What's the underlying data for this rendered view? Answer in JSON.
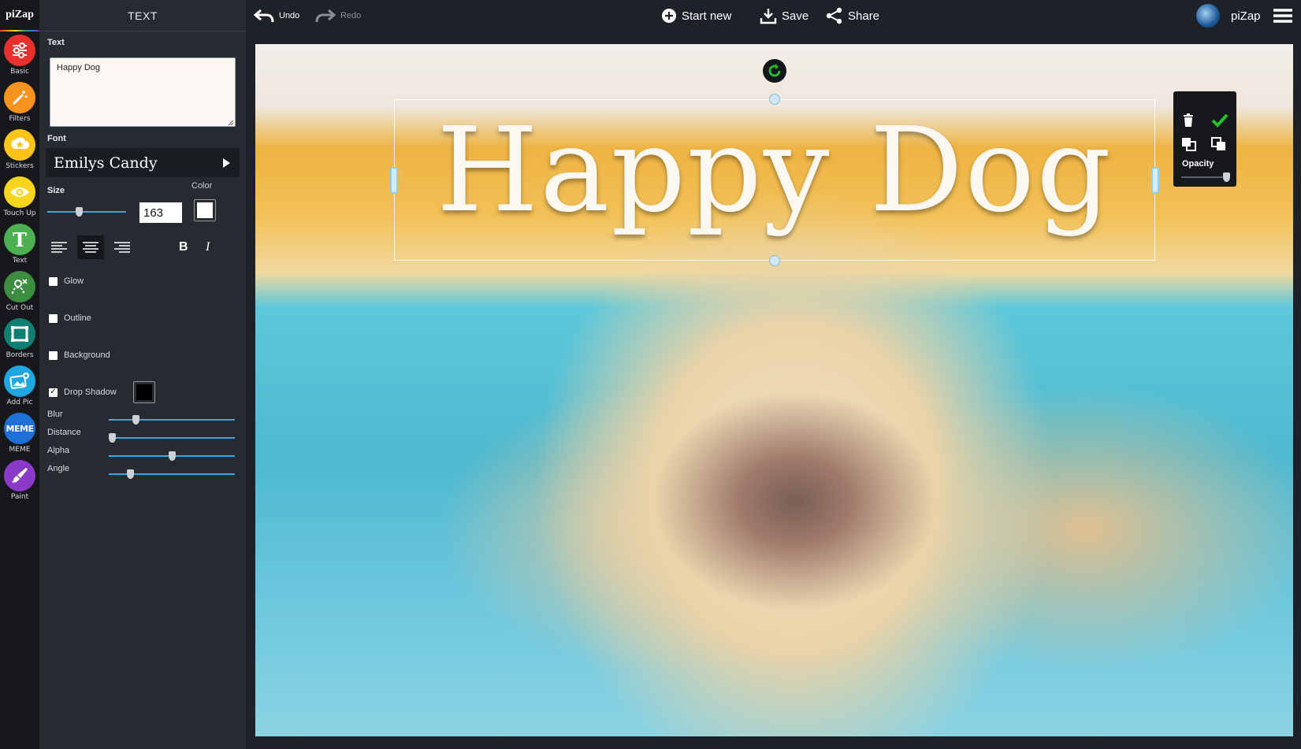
{
  "app": {
    "logo": "piZap"
  },
  "tools": [
    {
      "label": "Basic",
      "icon": "sliders-icon",
      "color": "#e8302d"
    },
    {
      "label": "Filters",
      "icon": "magic-wand-icon",
      "color": "#f7931e"
    },
    {
      "label": "Stickers",
      "icon": "stickers-icon",
      "color": "#fcc419"
    },
    {
      "label": "Touch Up",
      "icon": "eye-icon",
      "color": "#f7d51d"
    },
    {
      "label": "Text",
      "icon": "text-t-icon",
      "color": "#4caf50"
    },
    {
      "label": "Cut Out",
      "icon": "cutout-person-icon",
      "color": "#3c8d40"
    },
    {
      "label": "Borders",
      "icon": "border-frame-icon",
      "color": "#0f7f72"
    },
    {
      "label": "Add Pic",
      "icon": "add-picture-icon",
      "color": "#1ea7e0"
    },
    {
      "label": "MEME",
      "icon": "meme-icon",
      "color": "#1e6fd6"
    },
    {
      "label": "Paint",
      "icon": "paint-brush-icon",
      "color": "#8a3ac8"
    }
  ],
  "meme_icon_text": "MEME",
  "text_icon_glyph": "T",
  "panel": {
    "title": "TEXT",
    "text_label": "Text",
    "text_value": "Happy Dog",
    "font_label": "Font",
    "font_name": "Emilys Candy",
    "size_label": "Size",
    "size_value": "163",
    "size_level": 0.4,
    "color_label": "Color",
    "text_color": "#ffffff",
    "bold": "B",
    "italic": "I",
    "glow": {
      "label": "Glow",
      "checked": false
    },
    "outline": {
      "label": "Outline",
      "checked": false
    },
    "background": {
      "label": "Background",
      "checked": false
    },
    "drop_shadow": {
      "label": "Drop Shadow",
      "checked": true,
      "check_mark": "✓",
      "color": "#000000"
    },
    "sliders": [
      {
        "label": "Blur",
        "level": 0.2
      },
      {
        "label": "Distance",
        "level": 0.0
      },
      {
        "label": "Alpha",
        "level": 0.5
      },
      {
        "label": "Angle",
        "level": 0.15
      }
    ]
  },
  "topbar": {
    "undo": "Undo",
    "redo": "Redo",
    "start_new": "Start new",
    "save": "Save",
    "share": "Share",
    "username": "piZap"
  },
  "canvas": {
    "text": "Happy Dog",
    "accent": "#39a9d9",
    "confirm_color": "#22c22a"
  },
  "float_panel": {
    "opacity_label": "Opacity",
    "opacity_level": 1.0
  }
}
